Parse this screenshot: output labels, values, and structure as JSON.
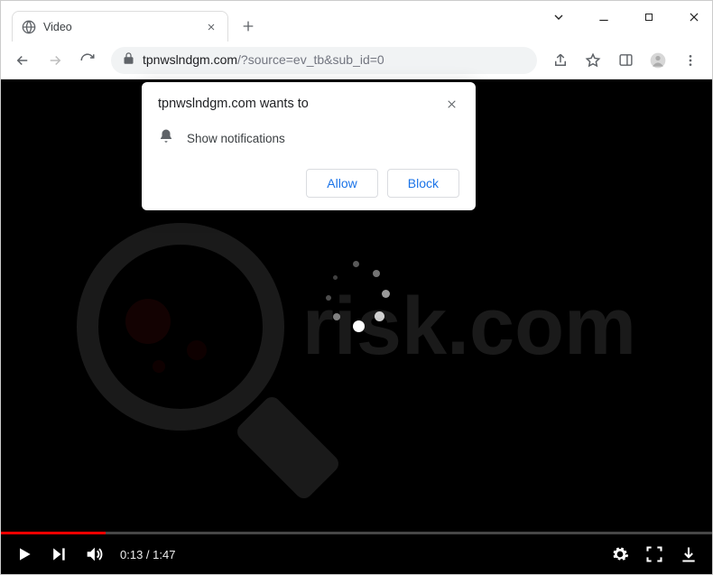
{
  "window": {
    "title": "Video"
  },
  "tab": {
    "title": "Video"
  },
  "omnibox": {
    "domain": "tpnwslndgm.com",
    "path": "/?source=ev_tb&sub_id=0"
  },
  "watermark": {
    "text": "risk.com"
  },
  "prompt": {
    "heading_site": "tpnwslndgm.com",
    "heading_suffix": " wants to",
    "message": "Show notifications",
    "allow": "Allow",
    "block": "Block"
  },
  "video": {
    "current": "0:13",
    "duration": "1:47",
    "progress_pct": 14.7
  }
}
